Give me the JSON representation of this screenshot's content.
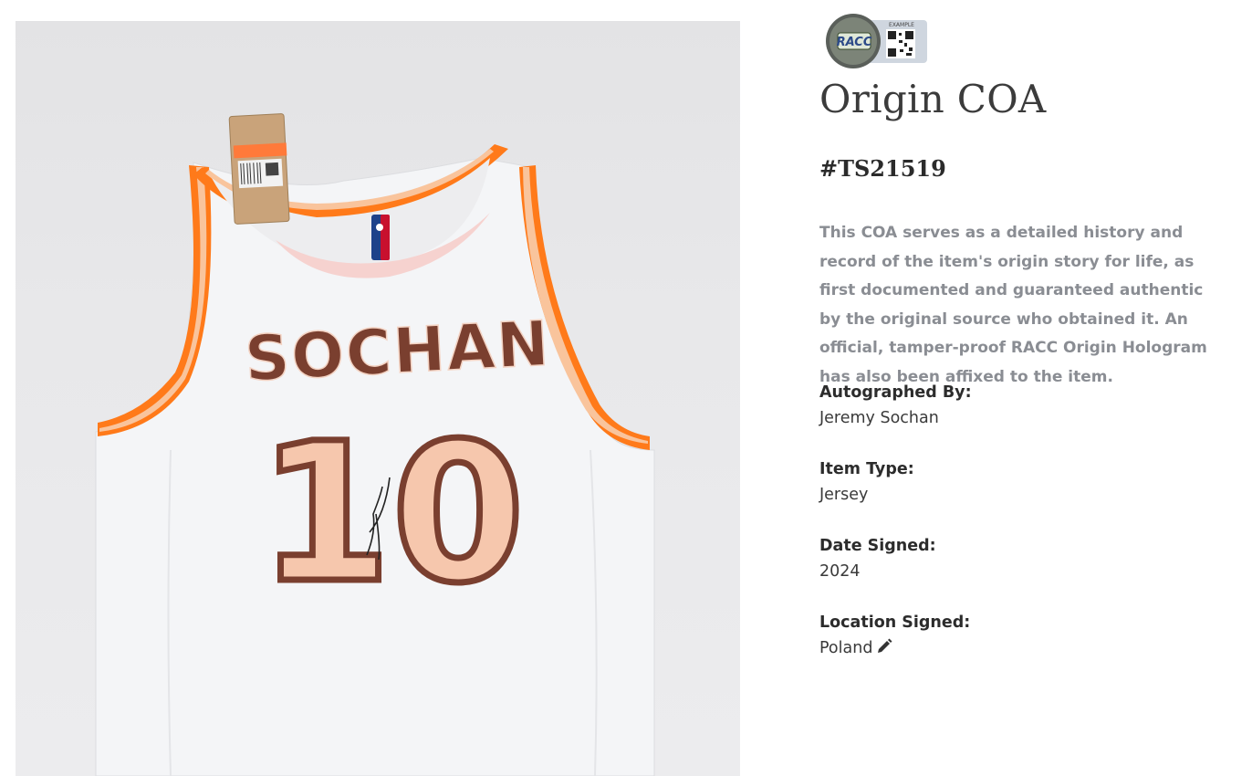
{
  "coa": {
    "title": "Origin COA",
    "id": "#TS21519",
    "description": "This COA serves as a detailed history and record of the item's origin story for life, as first documented and guaranteed authentic by the original source who obtained it. An official, tamper-proof RACC Origin Hologram has also been affixed to the item."
  },
  "hologram": {
    "brand": "RACC",
    "stamp": "EXAMPLE"
  },
  "jersey": {
    "name": "SOCHAN",
    "number": "10"
  },
  "fields": {
    "autographed_by": {
      "label": "Autographed By:",
      "value": "Jeremy Sochan"
    },
    "item_type": {
      "label": "Item Type:",
      "value": "Jersey"
    },
    "date_signed": {
      "label": "Date Signed:",
      "value": "2024"
    },
    "location_signed": {
      "label": "Location Signed:",
      "value": "Poland"
    }
  },
  "icons": {
    "edit": "pencil-icon"
  }
}
